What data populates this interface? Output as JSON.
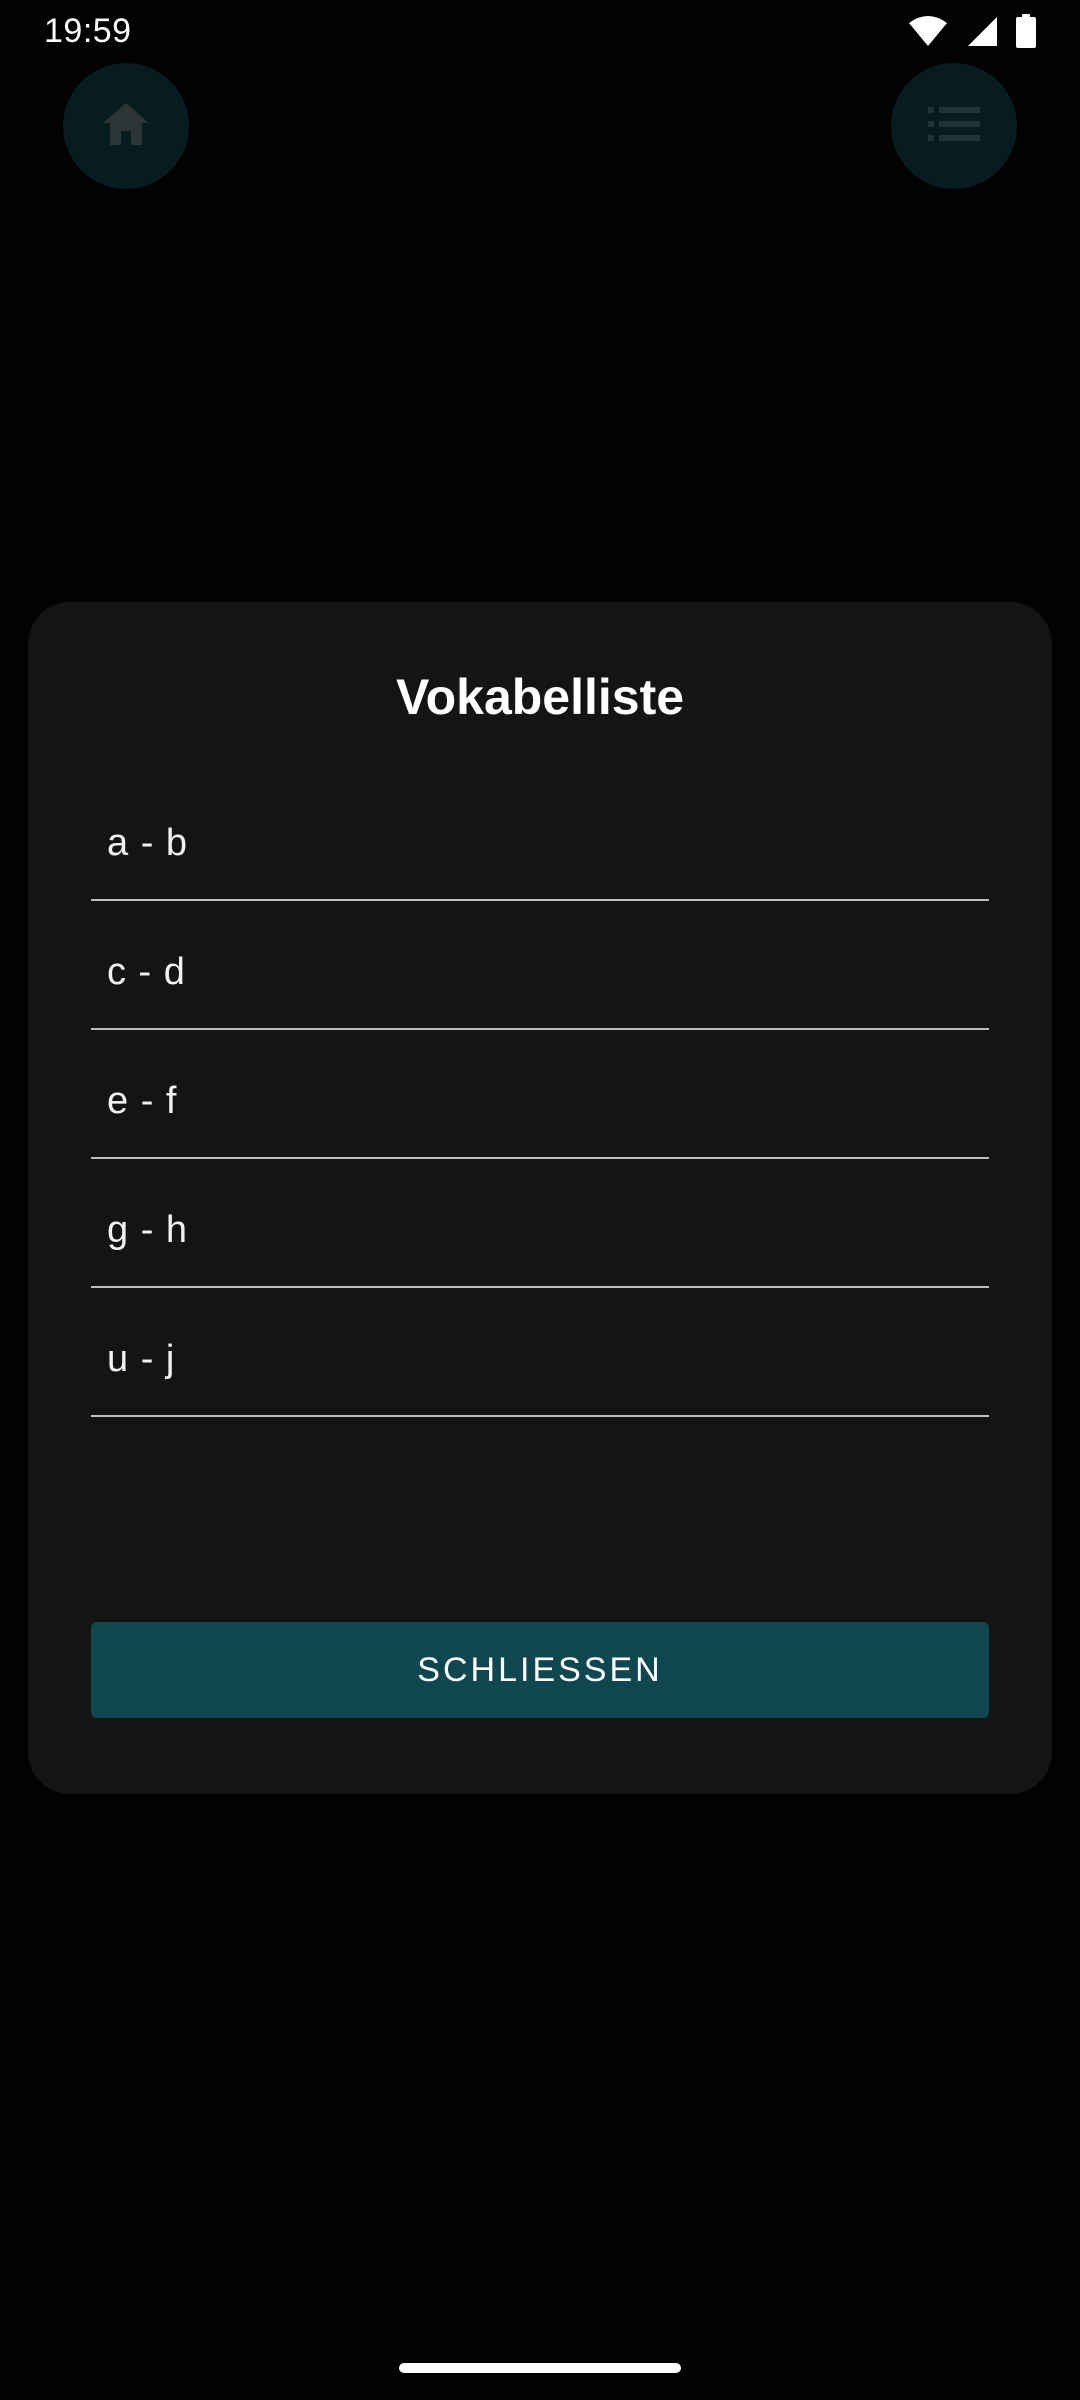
{
  "status_bar": {
    "time": "19:59",
    "icons": [
      "wifi-icon",
      "signal-icon",
      "battery-icon"
    ]
  },
  "background_app": {
    "fab_left_icon": "home-icon",
    "fab_right_icon": "list-icon"
  },
  "dialog": {
    "title": "Vokabelliste",
    "items": [
      {
        "label": "a - b"
      },
      {
        "label": "c - d"
      },
      {
        "label": "e - f"
      },
      {
        "label": "g - h"
      },
      {
        "label": "u - j"
      }
    ],
    "close_label": "SCHLIESSEN"
  },
  "colors": {
    "background": "#020202",
    "dialog_surface": "#141414",
    "accent_button": "#0f4751",
    "divider": "#bdbdbd",
    "fab_dimmed": "#061c1f"
  }
}
